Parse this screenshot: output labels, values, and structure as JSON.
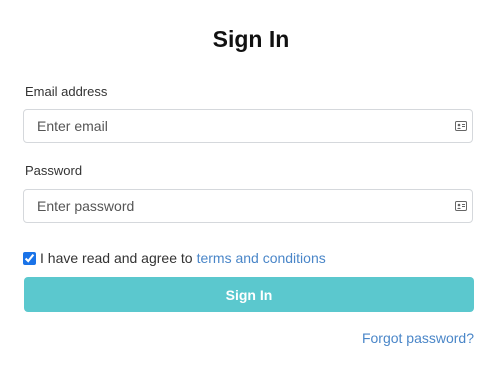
{
  "page": {
    "title": "Sign In"
  },
  "email": {
    "label": "Email address",
    "placeholder": "Enter email",
    "value": ""
  },
  "password": {
    "label": "Password",
    "placeholder": "Enter password",
    "value": ""
  },
  "agreement": {
    "checked": true,
    "text": "I have read and agree to",
    "link_text": "terms and conditions"
  },
  "actions": {
    "signin_label": "Sign In",
    "forgot_label": "Forgot password?"
  },
  "icons": {
    "autofill": "contact-card-icon",
    "checkbox": "checkbox-checked"
  },
  "colors": {
    "primary_button": "#5bc8ce",
    "link": "#4a86c8",
    "input_border": "#d5d8dc"
  }
}
